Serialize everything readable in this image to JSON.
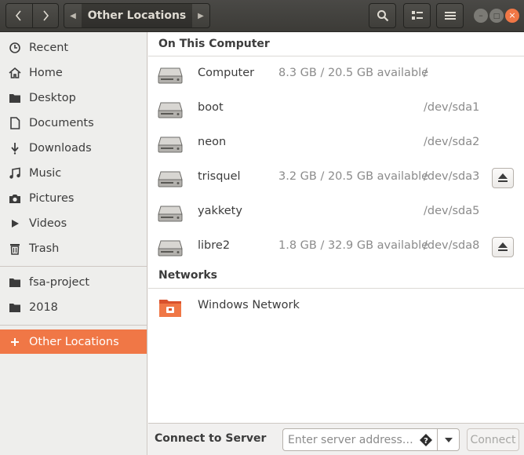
{
  "window": {
    "location_title": "Other Locations",
    "colors": {
      "titlebar": "#3c3b37",
      "accent": "#f07746",
      "close": "#f07746"
    }
  },
  "toolbar": {
    "back_icon": "chevron-left-icon",
    "forward_icon": "chevron-right-icon",
    "search_icon": "search-icon",
    "view_icon": "list-view-icon",
    "menu_icon": "hamburger-menu-icon"
  },
  "sidebar": {
    "places": [
      {
        "label": "Recent",
        "icon": "clock-icon"
      },
      {
        "label": "Home",
        "icon": "home-icon"
      },
      {
        "label": "Desktop",
        "icon": "folder-icon"
      },
      {
        "label": "Documents",
        "icon": "document-icon"
      },
      {
        "label": "Downloads",
        "icon": "download-icon"
      },
      {
        "label": "Music",
        "icon": "music-icon"
      },
      {
        "label": "Pictures",
        "icon": "camera-icon"
      },
      {
        "label": "Videos",
        "icon": "video-icon"
      },
      {
        "label": "Trash",
        "icon": "trash-icon"
      }
    ],
    "bookmarks": [
      {
        "label": "fsa-project",
        "icon": "folder-icon"
      },
      {
        "label": "2018",
        "icon": "folder-icon"
      }
    ],
    "other_locations": {
      "label": "Other Locations",
      "icon": "plus-icon",
      "active": true
    }
  },
  "main": {
    "on_this_computer": {
      "header": "On This Computer",
      "drives": [
        {
          "name": "Computer",
          "available": "8.3 GB / 20.5 GB available",
          "device": "/",
          "ejectable": false
        },
        {
          "name": "boot",
          "available": "",
          "device": "/dev/sda1",
          "ejectable": false
        },
        {
          "name": "neon",
          "available": "",
          "device": "/dev/sda2",
          "ejectable": false
        },
        {
          "name": "trisquel",
          "available": "3.2 GB / 20.5 GB available",
          "device": "/dev/sda3",
          "ejectable": true
        },
        {
          "name": "yakkety",
          "available": "",
          "device": "/dev/sda5",
          "ejectable": false
        },
        {
          "name": "libre2",
          "available": "1.8 GB / 32.9 GB available",
          "device": "/dev/sda8",
          "ejectable": true
        }
      ]
    },
    "networks": {
      "header": "Networks",
      "items": [
        {
          "name": "Windows Network",
          "icon": "network-folder-icon"
        }
      ]
    }
  },
  "connect": {
    "label": "Connect to Server",
    "placeholder": "Enter server address…",
    "button": "Connect"
  }
}
